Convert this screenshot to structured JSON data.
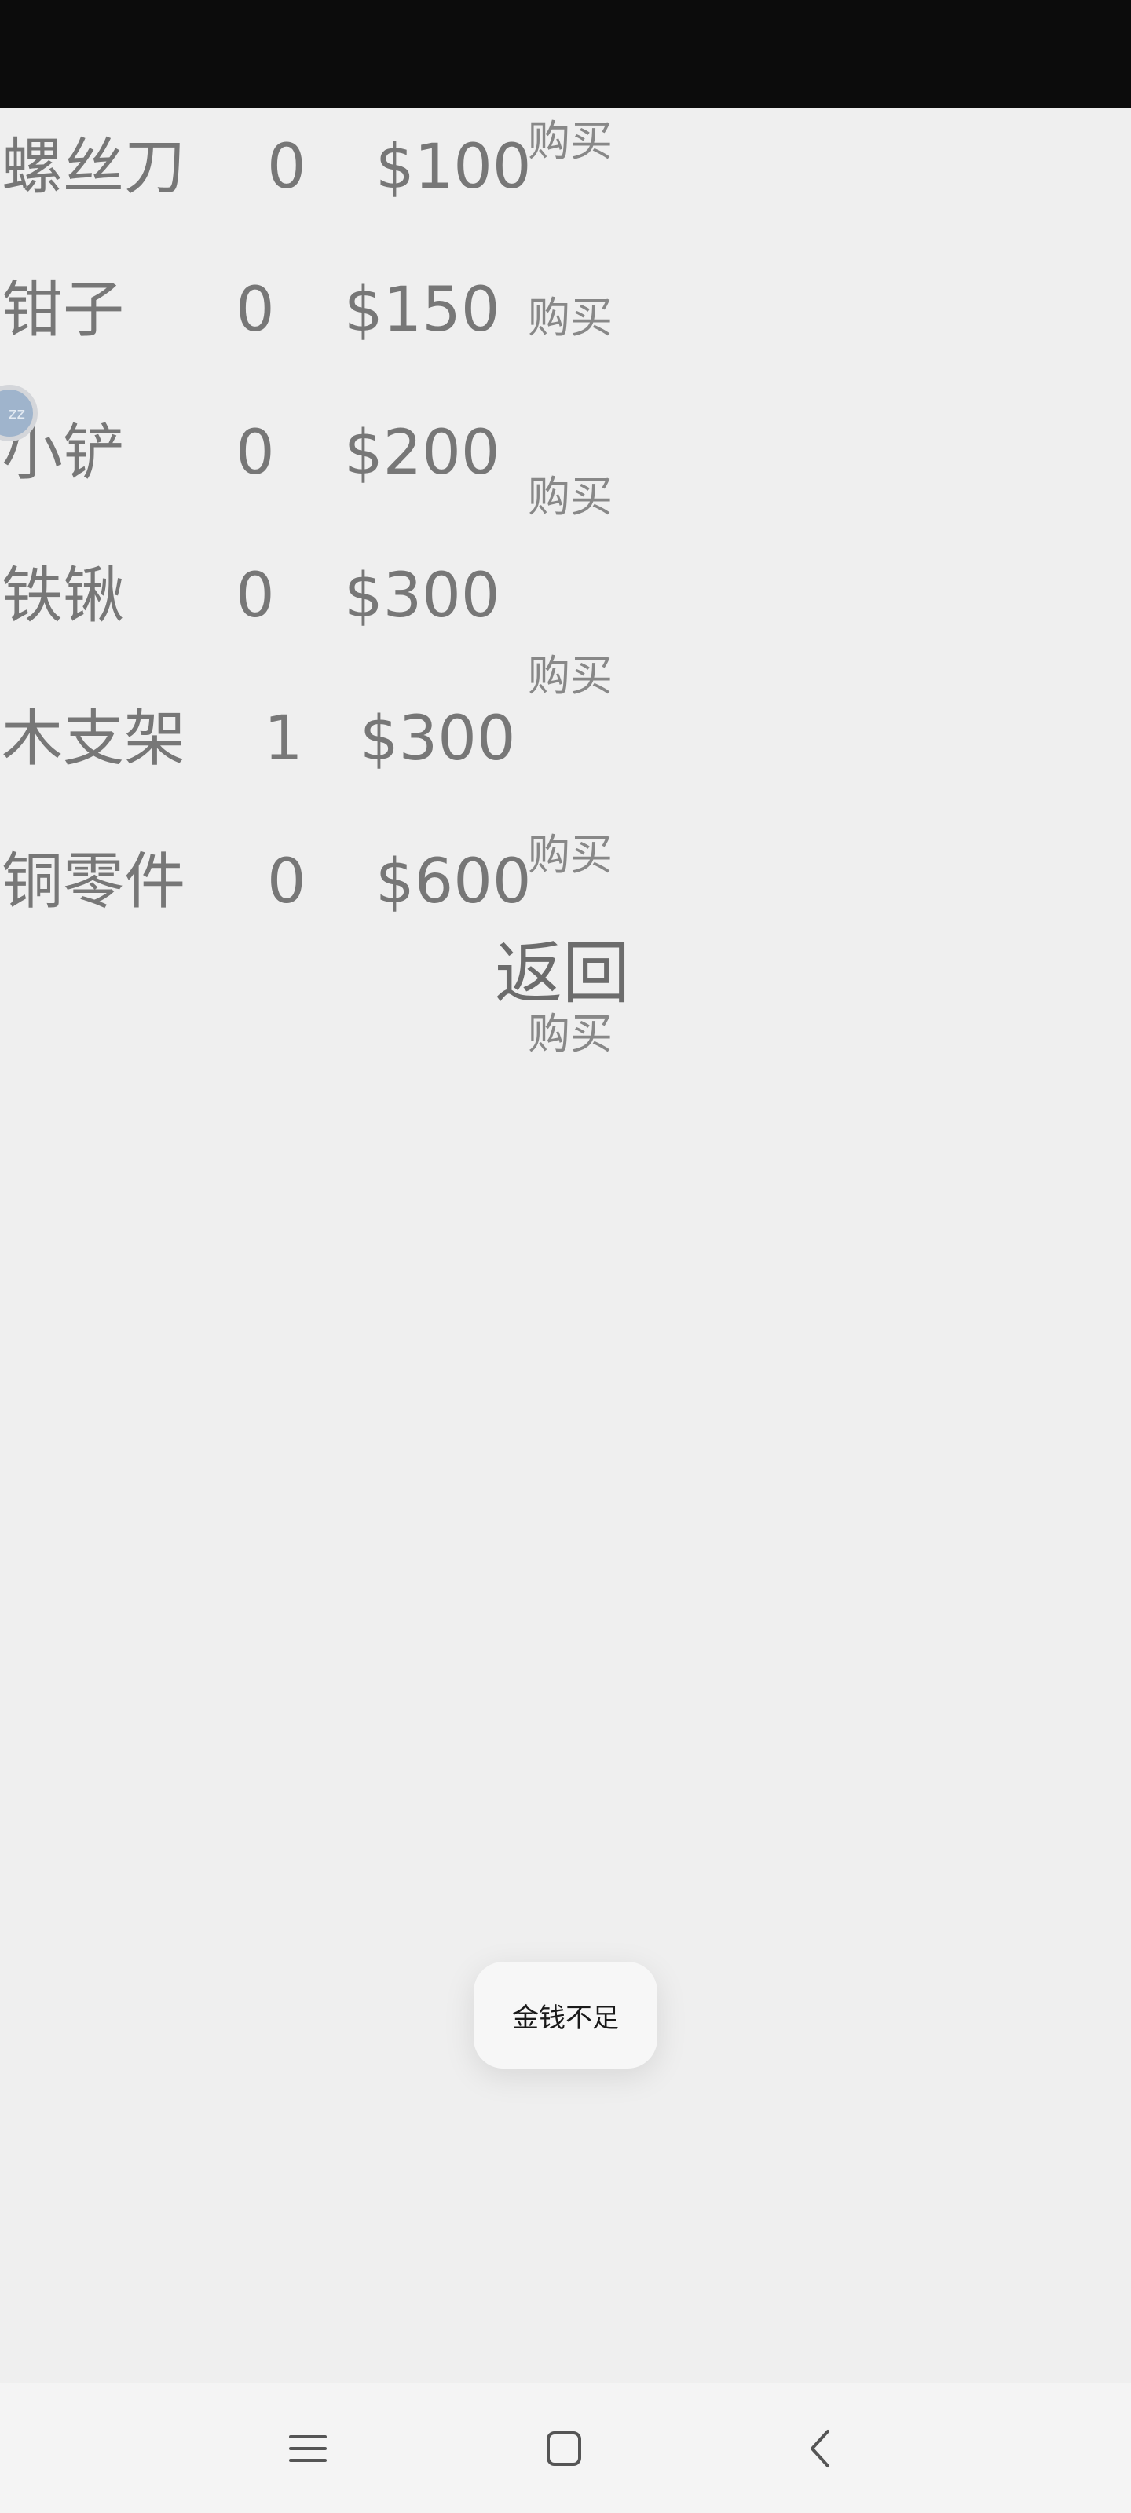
{
  "shop": {
    "items": [
      {
        "name": "螺丝刀",
        "count": "0",
        "price": "$100"
      },
      {
        "name": "钳子",
        "count": "0",
        "price": "$150"
      },
      {
        "name": "小铲",
        "count": "0",
        "price": "$200"
      },
      {
        "name": "铁锹",
        "count": "0",
        "price": "$300"
      },
      {
        "name": "木支架",
        "count": "1",
        "price": "$300"
      },
      {
        "name": "铜零件",
        "count": "0",
        "price": "$600"
      }
    ],
    "buy_label": "购买",
    "back_label": "返回"
  },
  "floating_ball": {
    "text": "zz"
  },
  "toast": {
    "message": "金钱不足"
  },
  "nav": {
    "icons": [
      "menu-icon",
      "home-icon",
      "back-icon"
    ]
  }
}
